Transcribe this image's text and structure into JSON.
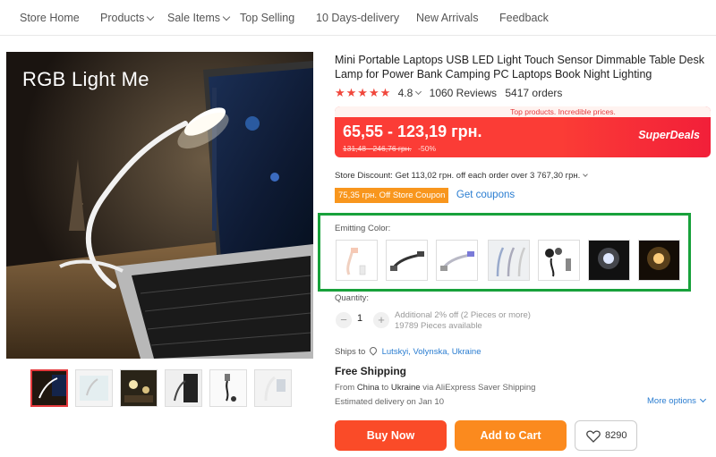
{
  "nav": {
    "items": [
      {
        "label": "Store Home",
        "dropdown": false
      },
      {
        "label": "Products",
        "dropdown": true
      },
      {
        "label": "Sale Items",
        "dropdown": true
      },
      {
        "label": "Top Selling",
        "dropdown": false
      },
      {
        "label": "10 Days-delivery",
        "dropdown": false
      },
      {
        "label": "New Arrivals",
        "dropdown": false
      },
      {
        "label": "Feedback",
        "dropdown": false
      }
    ]
  },
  "gallery": {
    "main_caption": "RGB Light Me",
    "thumbnail_count": 6,
    "selected_thumbnail": 0
  },
  "product": {
    "title": "Mini Portable Laptops USB LED Light Touch Sensor Dimmable Table Desk Lamp for Power Bank Camping PC Laptops Book Night Lighting",
    "rating": {
      "stars": 5,
      "score": "4.8",
      "reviews": "1060 Reviews",
      "orders": "5417 orders"
    }
  },
  "deal": {
    "banner": "Top products. Incredible prices.",
    "price": "65,55 - 123,19 грн.",
    "old_price": "131,48 - 246,76 грн.",
    "discount": "-50%",
    "tag": "SuperDeals"
  },
  "store_discount": "Store Discount: Get 113,02 грн. off each order over 3 767,30 грн.",
  "coupon": {
    "label": "75,35 грн. Off Store Coupon",
    "link": "Get coupons"
  },
  "emitting_color": {
    "label": "Emitting Color:",
    "options": [
      "white-lamp",
      "black-lamp",
      "blue-lamp",
      "three-lamps",
      "lamp-parts",
      "cool-light",
      "warm-light"
    ]
  },
  "quantity": {
    "label": "Quantity:",
    "value": "1",
    "minus": "−",
    "plus": "+",
    "offer": "Additional 2% off (2 Pieces or more)",
    "available": "19789 Pieces available"
  },
  "shipping": {
    "ships_to": "Ships to",
    "location": "Lutskyi, Volynska, Ukraine",
    "free": "Free Shipping",
    "from_prefix": "From",
    "from": "China",
    "to_prefix": "to",
    "to": "Ukraine",
    "via": "via AliExpress Saver Shipping",
    "delivery": "Estimated delivery on Jan 10",
    "more_options": "More options"
  },
  "actions": {
    "buy_now": "Buy Now",
    "add_to_cart": "Add to Cart",
    "wishlist_count": "8290"
  },
  "colors": {
    "deal_red": "#fb3c36",
    "buy_red": "#fa4b28",
    "cart_orange": "#fb8a1e",
    "coupon_orange": "#f8961d",
    "link_blue": "#2a7dd1",
    "highlight_green": "#18a13b",
    "star_red": "#f0473c"
  }
}
